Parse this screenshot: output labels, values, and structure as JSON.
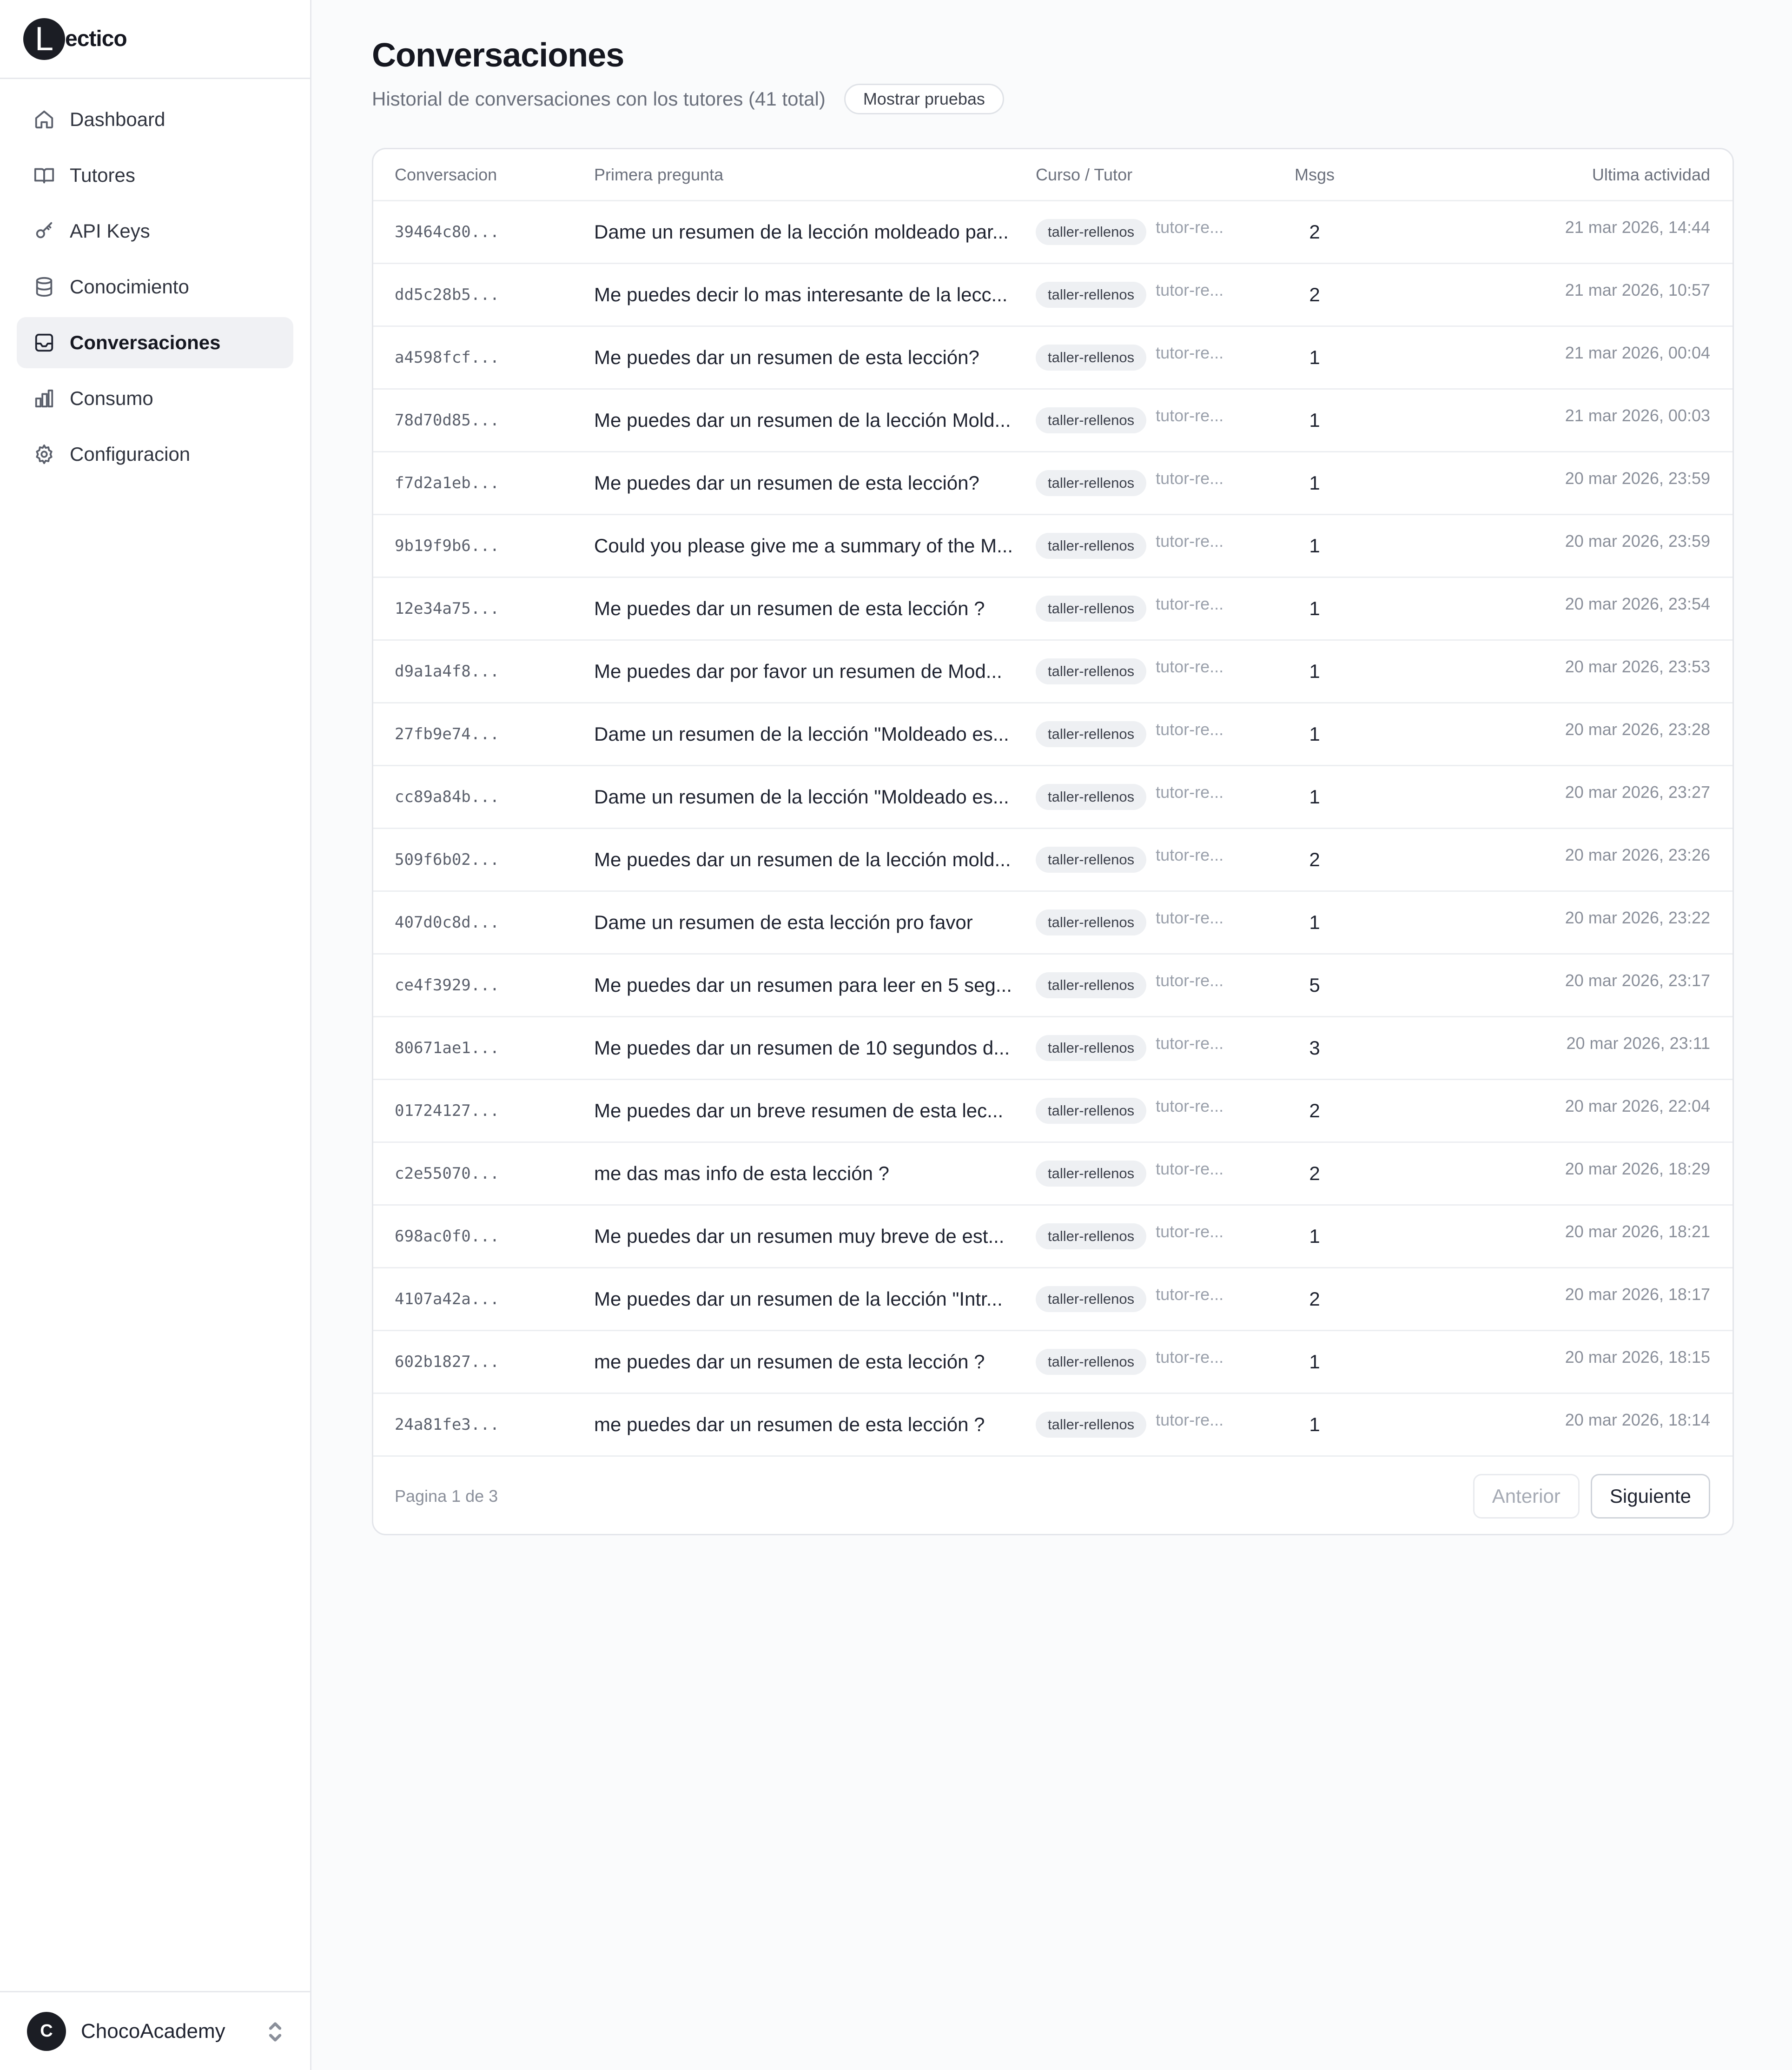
{
  "brand": {
    "mark": "L",
    "text": "ectico"
  },
  "nav": [
    {
      "id": "dashboard",
      "label": "Dashboard",
      "icon": "home-icon",
      "active": false
    },
    {
      "id": "tutores",
      "label": "Tutores",
      "icon": "book-open-icon",
      "active": false
    },
    {
      "id": "api-keys",
      "label": "API Keys",
      "icon": "key-icon",
      "active": false
    },
    {
      "id": "conocimiento",
      "label": "Conocimiento",
      "icon": "database-icon",
      "active": false
    },
    {
      "id": "conversaciones",
      "label": "Conversaciones",
      "icon": "inbox-icon",
      "active": true
    },
    {
      "id": "consumo",
      "label": "Consumo",
      "icon": "bar-chart-icon",
      "active": false
    },
    {
      "id": "configuracion",
      "label": "Configuracion",
      "icon": "gear-icon",
      "active": false
    }
  ],
  "org": {
    "avatar": "C",
    "name": "ChocoAcademy"
  },
  "page": {
    "title": "Conversaciones",
    "subtitle": "Historial de conversaciones con los tutores (41 total)",
    "toggle_label": "Mostrar pruebas"
  },
  "table": {
    "headers": {
      "id": "Conversacion",
      "question": "Primera pregunta",
      "tutor": "Curso / Tutor",
      "msgs": "Msgs",
      "time": "Ultima actividad"
    },
    "rows": [
      {
        "id": "39464c80...",
        "question": "Dame un resumen de la lección moldeado par...",
        "course": "taller-rellenos",
        "tutor": "tutor-re...",
        "msgs": "2",
        "time": "21 mar 2026, 14:44"
      },
      {
        "id": "dd5c28b5...",
        "question": "Me puedes decir lo mas interesante de la lecc...",
        "course": "taller-rellenos",
        "tutor": "tutor-re...",
        "msgs": "2",
        "time": "21 mar 2026, 10:57"
      },
      {
        "id": "a4598fcf...",
        "question": "Me puedes dar un resumen de esta lección?",
        "course": "taller-rellenos",
        "tutor": "tutor-re...",
        "msgs": "1",
        "time": "21 mar 2026, 00:04"
      },
      {
        "id": "78d70d85...",
        "question": "Me puedes dar un resumen de la lección Mold...",
        "course": "taller-rellenos",
        "tutor": "tutor-re...",
        "msgs": "1",
        "time": "21 mar 2026, 00:03"
      },
      {
        "id": "f7d2a1eb...",
        "question": "Me puedes dar un resumen de esta lección?",
        "course": "taller-rellenos",
        "tutor": "tutor-re...",
        "msgs": "1",
        "time": "20 mar 2026, 23:59"
      },
      {
        "id": "9b19f9b6...",
        "question": "Could you please give me a summary of the M...",
        "course": "taller-rellenos",
        "tutor": "tutor-re...",
        "msgs": "1",
        "time": "20 mar 2026, 23:59"
      },
      {
        "id": "12e34a75...",
        "question": "Me puedes dar un resumen de esta lección ?",
        "course": "taller-rellenos",
        "tutor": "tutor-re...",
        "msgs": "1",
        "time": "20 mar 2026, 23:54"
      },
      {
        "id": "d9a1a4f8...",
        "question": "Me puedes dar por favor un resumen de Mod...",
        "course": "taller-rellenos",
        "tutor": "tutor-re...",
        "msgs": "1",
        "time": "20 mar 2026, 23:53"
      },
      {
        "id": "27fb9e74...",
        "question": "Dame un resumen de la lección \"Moldeado es...",
        "course": "taller-rellenos",
        "tutor": "tutor-re...",
        "msgs": "1",
        "time": "20 mar 2026, 23:28"
      },
      {
        "id": "cc89a84b...",
        "question": "Dame un resumen de la lección \"Moldeado es...",
        "course": "taller-rellenos",
        "tutor": "tutor-re...",
        "msgs": "1",
        "time": "20 mar 2026, 23:27"
      },
      {
        "id": "509f6b02...",
        "question": "Me puedes dar un resumen de la lección mold...",
        "course": "taller-rellenos",
        "tutor": "tutor-re...",
        "msgs": "2",
        "time": "20 mar 2026, 23:26"
      },
      {
        "id": "407d0c8d...",
        "question": "Dame un resumen de esta lección pro favor",
        "course": "taller-rellenos",
        "tutor": "tutor-re...",
        "msgs": "1",
        "time": "20 mar 2026, 23:22"
      },
      {
        "id": "ce4f3929...",
        "question": "Me puedes dar un resumen para leer en 5 seg...",
        "course": "taller-rellenos",
        "tutor": "tutor-re...",
        "msgs": "5",
        "time": "20 mar 2026, 23:17"
      },
      {
        "id": "80671ae1...",
        "question": "Me puedes dar un resumen de 10 segundos d...",
        "course": "taller-rellenos",
        "tutor": "tutor-re...",
        "msgs": "3",
        "time": "20 mar 2026, 23:11"
      },
      {
        "id": "01724127...",
        "question": "Me puedes dar un breve resumen de esta lec...",
        "course": "taller-rellenos",
        "tutor": "tutor-re...",
        "msgs": "2",
        "time": "20 mar 2026, 22:04"
      },
      {
        "id": "c2e55070...",
        "question": "me das mas info de esta lección ?",
        "course": "taller-rellenos",
        "tutor": "tutor-re...",
        "msgs": "2",
        "time": "20 mar 2026, 18:29"
      },
      {
        "id": "698ac0f0...",
        "question": "Me puedes dar un resumen muy breve de est...",
        "course": "taller-rellenos",
        "tutor": "tutor-re...",
        "msgs": "1",
        "time": "20 mar 2026, 18:21"
      },
      {
        "id": "4107a42a...",
        "question": "Me puedes dar un resumen de la lección \"Intr...",
        "course": "taller-rellenos",
        "tutor": "tutor-re...",
        "msgs": "2",
        "time": "20 mar 2026, 18:17"
      },
      {
        "id": "602b1827...",
        "question": "me puedes dar un resumen de esta lección ?",
        "course": "taller-rellenos",
        "tutor": "tutor-re...",
        "msgs": "1",
        "time": "20 mar 2026, 18:15"
      },
      {
        "id": "24a81fe3...",
        "question": "me puedes dar un resumen de esta lección ?",
        "course": "taller-rellenos",
        "tutor": "tutor-re...",
        "msgs": "1",
        "time": "20 mar 2026, 18:14"
      }
    ]
  },
  "pager": {
    "info": "Pagina 1 de 3",
    "prev_label": "Anterior",
    "next_label": "Siguiente"
  }
}
